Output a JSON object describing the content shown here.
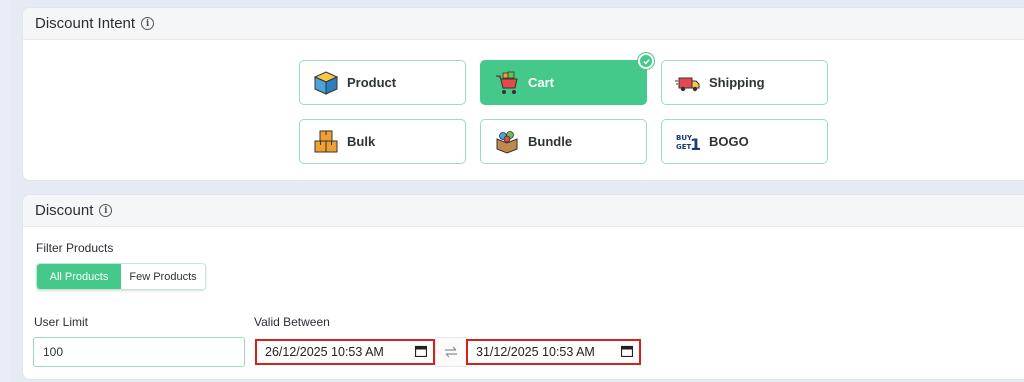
{
  "intent": {
    "title": "Discount Intent",
    "options": [
      {
        "label": "Product",
        "icon": "box-icon",
        "selected": false
      },
      {
        "label": "Cart",
        "icon": "cart-icon",
        "selected": true
      },
      {
        "label": "Shipping",
        "icon": "truck-icon",
        "selected": false
      },
      {
        "label": "Bulk",
        "icon": "boxes-icon",
        "selected": false
      },
      {
        "label": "Bundle",
        "icon": "bundle-box-icon",
        "selected": false
      },
      {
        "label": "BOGO",
        "icon": "buy-get-1-icon",
        "selected": false
      }
    ]
  },
  "discount": {
    "title": "Discount",
    "filter_label": "Filter Products",
    "filter_options": [
      {
        "label": "All Products",
        "active": true
      },
      {
        "label": "Few Products",
        "active": false
      }
    ],
    "user_limit_label": "User Limit",
    "user_limit_value": "100",
    "valid_between_label": "Valid Between",
    "start_date": "26/12/2025 10:53 AM",
    "end_date": "31/12/2025 10:53 AM"
  },
  "colors": {
    "accent": "#45c98a",
    "highlight_border": "#d62020"
  }
}
